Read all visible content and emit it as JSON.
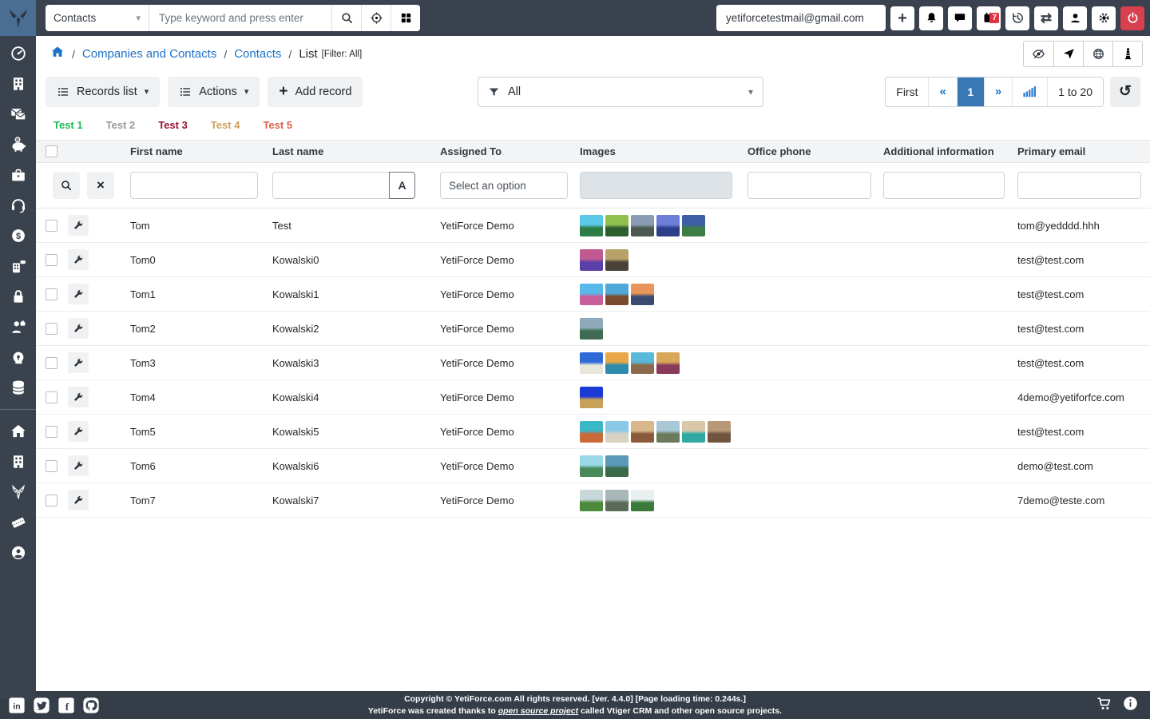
{
  "topbar": {
    "module_select_value": "Contacts",
    "caret": "▾",
    "search_placeholder": "Type keyword and press enter",
    "email_value": "yetiforcetestmail@gmail.com",
    "plus_glyph": "+",
    "swap_glyph": "⇄",
    "calendar_badge": "7"
  },
  "breadcrumb": {
    "separator": "/",
    "link1": "Companies and Contacts",
    "link2": "Contacts",
    "current": "List",
    "filter_suffix": "[Filter: All]"
  },
  "toolbar": {
    "records_list_label": "Records list",
    "actions_label": "Actions",
    "add_record_plus": "+",
    "add_record_label": "Add record",
    "caret": "▾"
  },
  "filter": {
    "value": "All",
    "caret": "▾"
  },
  "pagination": {
    "first_label": "First",
    "prev_glyph": "«",
    "page": "1",
    "next_glyph": "»",
    "range_label": "1 to 20",
    "refresh_glyph": "↺"
  },
  "tabs": [
    {
      "label": "Test 1",
      "color": "#1ebc53"
    },
    {
      "label": "Test 2",
      "color": "#97999c"
    },
    {
      "label": "Test 3",
      "color": "#9d1230"
    },
    {
      "label": "Test 4",
      "color": "#cfa05c"
    },
    {
      "label": "Test 5",
      "color": "#df6046"
    }
  ],
  "table": {
    "columns": [
      "First name",
      "Last name",
      "Assigned To",
      "Images",
      "Office phone",
      "Additional information",
      "Primary email"
    ],
    "search": {
      "assigned_placeholder": "Select an option",
      "case_button": "A",
      "clear_glyph": "×"
    },
    "rows": [
      {
        "first": "Tom",
        "last": "Test",
        "assigned": "YetiForce Demo",
        "phone": "",
        "additional": "",
        "email": "tom@yedddd.hhh",
        "thumbs": [
          [
            "#5bc8e8",
            "#2f7d46"
          ],
          [
            "#8fbf4e",
            "#2c5e2e"
          ],
          [
            "#8a9cb5",
            "#4a5a50"
          ],
          [
            "#6f7fd8",
            "#2b3f8a"
          ],
          [
            "#3c5fa8",
            "#3f7d46"
          ]
        ]
      },
      {
        "first": "Tom0",
        "last": "Kowalski0",
        "assigned": "YetiForce Demo",
        "phone": "",
        "additional": "",
        "email": "test@test.com",
        "thumbs": [
          [
            "#c05a90",
            "#5a3fa8"
          ],
          [
            "#b8a26a",
            "#4a4236"
          ]
        ]
      },
      {
        "first": "Tom1",
        "last": "Kowalski1",
        "assigned": "YetiForce Demo",
        "phone": "",
        "additional": "",
        "email": "test@test.com",
        "thumbs": [
          [
            "#58b8e8",
            "#c85f9a"
          ],
          [
            "#50a8d8",
            "#7a4a2e"
          ],
          [
            "#e8965a",
            "#3a4a70"
          ]
        ]
      },
      {
        "first": "Tom2",
        "last": "Kowalski2",
        "assigned": "YetiForce Demo",
        "phone": "",
        "additional": "",
        "email": "test@test.com",
        "thumbs": [
          [
            "#8fa8ba",
            "#3e6b52"
          ]
        ]
      },
      {
        "first": "Tom3",
        "last": "Kowalski3",
        "assigned": "YetiForce Demo",
        "phone": "",
        "additional": "",
        "email": "test@test.com",
        "thumbs": [
          [
            "#2e6bd8",
            "#e8e6da"
          ],
          [
            "#e8a84a",
            "#2e8bab"
          ],
          [
            "#5ab8da",
            "#8a6a4a"
          ],
          [
            "#d8a858",
            "#8a3a5a"
          ]
        ]
      },
      {
        "first": "Tom4",
        "last": "Kowalski4",
        "assigned": "YetiForce Demo",
        "phone": "",
        "additional": "",
        "email": "4demo@yetiforfce.com",
        "thumbs": [
          [
            "#1a3ad8",
            "#c8a05a"
          ]
        ]
      },
      {
        "first": "Tom5",
        "last": "Kowalski5",
        "assigned": "YetiForce Demo",
        "phone": "",
        "additional": "",
        "email": "test@test.com",
        "thumbs": [
          [
            "#3ab8c8",
            "#c86a3a"
          ],
          [
            "#8ac8e8",
            "#d8d2c2"
          ],
          [
            "#d8b88a",
            "#8a5a3a"
          ],
          [
            "#a8c8d8",
            "#6a7a5a"
          ],
          [
            "#d8c8a8",
            "#2ea8a0"
          ],
          [
            "#b89878",
            "#70543f"
          ]
        ]
      },
      {
        "first": "Tom6",
        "last": "Kowalski6",
        "assigned": "YetiForce Demo",
        "phone": "",
        "additional": "",
        "email": "demo@test.com",
        "thumbs": [
          [
            "#9ad8e8",
            "#4a8a5a"
          ],
          [
            "#5a9ab8",
            "#3a6a4a"
          ]
        ]
      },
      {
        "first": "Tom7",
        "last": "Kowalski7",
        "assigned": "YetiForce Demo",
        "phone": "",
        "additional": "",
        "email": "7demo@teste.com",
        "thumbs": [
          [
            "#c8d8da",
            "#4a8a3a"
          ],
          [
            "#a8b8b8",
            "#5a6a58"
          ],
          [
            "#e8f0f0",
            "#3a7a3a"
          ]
        ]
      }
    ]
  },
  "footer": {
    "copyright": "Copyright © YetiForce.com All rights reserved. [ver. 4.4.0] [Page loading time: 0.244s.]",
    "credit_pre": "YetiForce was created thanks to ",
    "credit_link": "open source project",
    "credit_post": " called Vtiger CRM and other open source projects."
  },
  "colors": {
    "dark_bar": "#39424e",
    "logo_blue": "#4a6d94",
    "link_blue": "#1d72c8",
    "active_page_blue": "#3878b4",
    "power_red": "#d8404f",
    "badge_red": "#e03444"
  },
  "icons": {
    "topbar": [
      "search-icon",
      "target-icon",
      "grid-icon",
      "plus-icon",
      "bell-icon",
      "chat-icon",
      "calendar-icon",
      "history-icon",
      "swap-icon",
      "user-icon",
      "gear-icon",
      "power-icon"
    ],
    "list_tools": [
      "eye-slash-icon",
      "send-icon",
      "globe-icon",
      "watchdog-icon"
    ],
    "sidebar": [
      "dashboard-icon",
      "companies-icon",
      "mail-icon",
      "piggy-bank-icon",
      "briefcase-icon",
      "helpdesk-icon",
      "finances-icon",
      "logistics-icon",
      "lock-icon",
      "hr-icon",
      "head-icon",
      "database-icon",
      "home-icon",
      "building-icon",
      "yetiforce-icon",
      "ticket-icon",
      "profile-icon"
    ],
    "footer": [
      "linkedin-icon",
      "twitter-icon",
      "facebook-icon",
      "github-icon",
      "cart-icon",
      "info-icon"
    ]
  }
}
